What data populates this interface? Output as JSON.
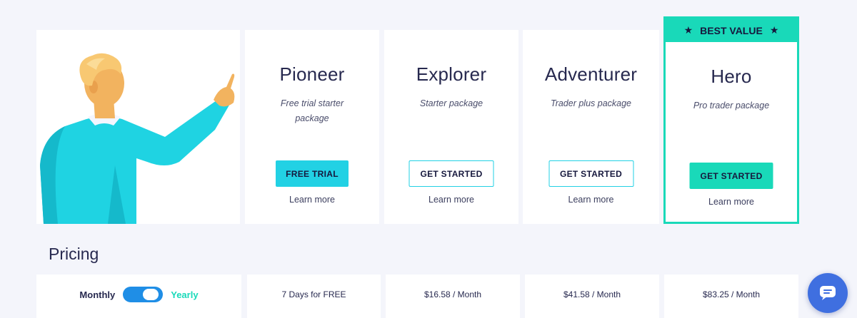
{
  "best_value": {
    "label": "BEST VALUE"
  },
  "plans": [
    {
      "name": "Pioneer",
      "desc": "Free trial starter package",
      "button": "FREE TRIAL",
      "learn_more": "Learn more",
      "price": "7 Days for FREE"
    },
    {
      "name": "Explorer",
      "desc": "Starter package",
      "button": "GET STARTED",
      "learn_more": "Learn more",
      "price": "$16.58 / Month"
    },
    {
      "name": "Adventurer",
      "desc": "Trader plus package",
      "button": "GET STARTED",
      "learn_more": "Learn more",
      "price": "$41.58 / Month"
    },
    {
      "name": "Hero",
      "desc": "Pro trader package",
      "button": "GET STARTED",
      "learn_more": "Learn more",
      "price": "$83.25 / Month"
    }
  ],
  "pricing": {
    "title": "Pricing",
    "toggle": {
      "left_label": "Monthly",
      "right_label": "Yearly",
      "selected": "Yearly"
    }
  },
  "colors": {
    "accent_cyan": "#22d1e4",
    "accent_green": "#19d9b9",
    "toggle_blue": "#1f8ee6",
    "chat_blue": "#3f6fe0",
    "text_dark": "#27294f"
  },
  "icons": {
    "star": "star-icon",
    "chat": "chat-icon"
  }
}
